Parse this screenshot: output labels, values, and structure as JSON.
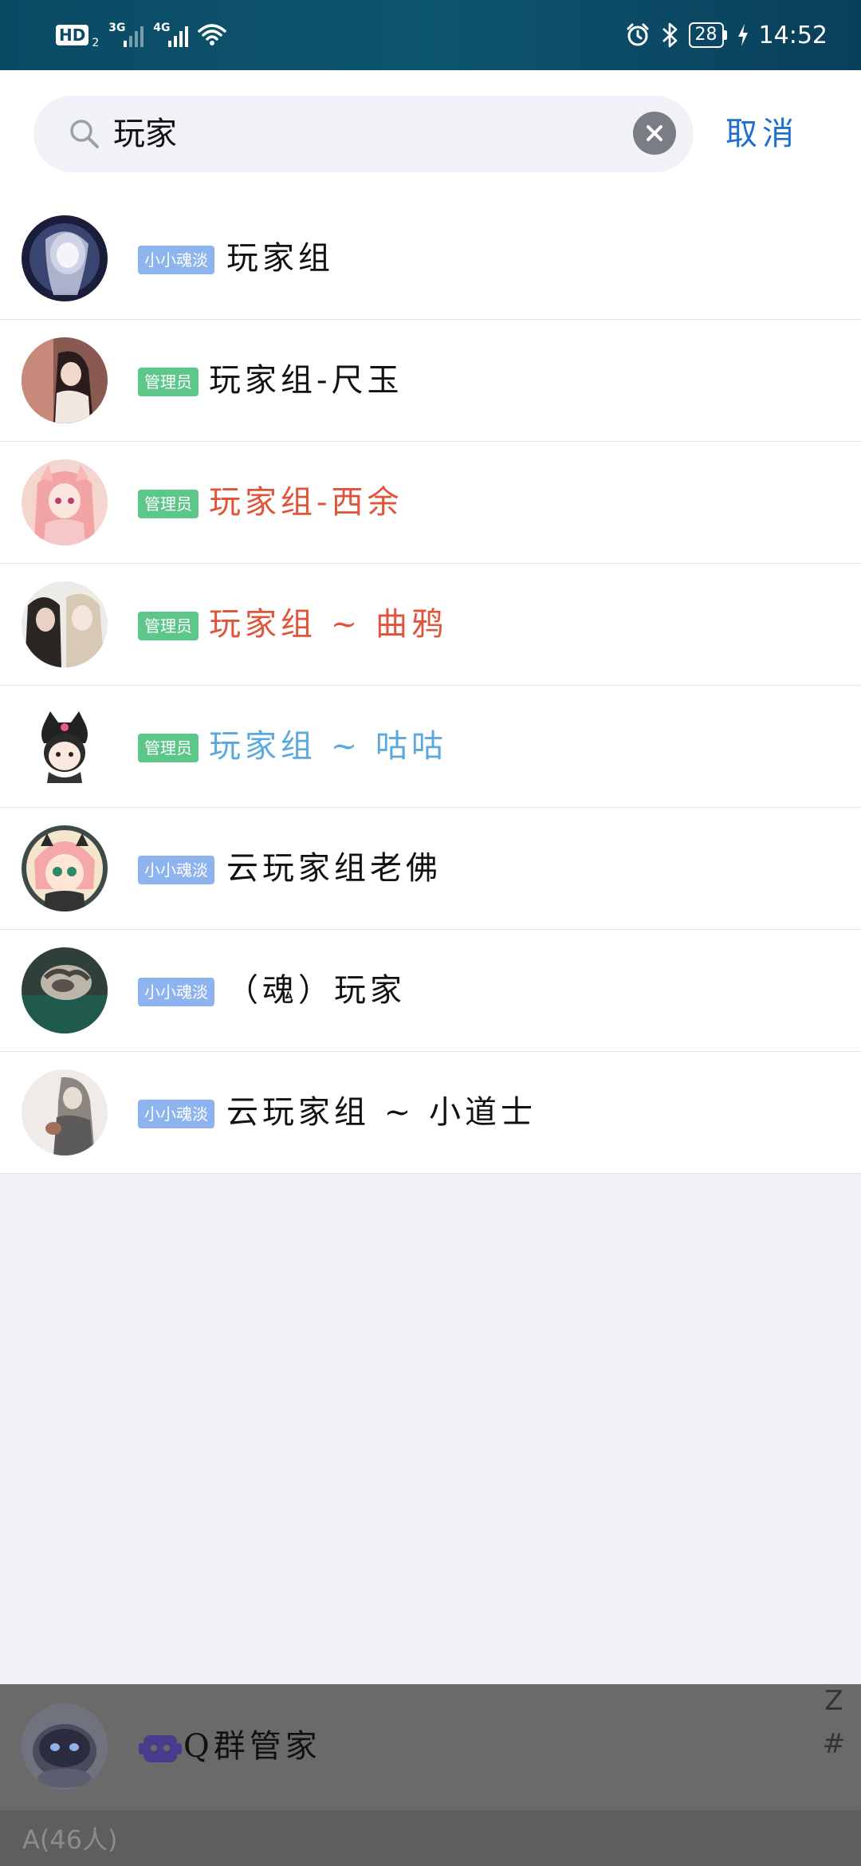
{
  "status_bar": {
    "hd": "HD",
    "hd_sub": "2",
    "net1": "3G",
    "net2": "4G",
    "battery": "28",
    "time": "14:52"
  },
  "search": {
    "query": "玩家",
    "cancel_label": "取消"
  },
  "results": [
    {
      "tag": "小小魂淡",
      "tag_type": "member",
      "name": "玩家组",
      "name_color": "#111111"
    },
    {
      "tag": "管理员",
      "tag_type": "admin",
      "name": "玩家组-尺玉",
      "name_color": "#111111"
    },
    {
      "tag": "管理员",
      "tag_type": "admin",
      "name": "玩家组-西余",
      "name_color": "#e0543a"
    },
    {
      "tag": "管理员",
      "tag_type": "admin",
      "name": "玩家组 ~ 曲鸦",
      "name_color": "#e0543a"
    },
    {
      "tag": "管理员",
      "tag_type": "admin",
      "name": "玩家组 ~ 咕咕",
      "name_color": "#5aa9dd"
    },
    {
      "tag": "小小魂淡",
      "tag_type": "member",
      "name": "云玩家组老佛",
      "name_color": "#111111"
    },
    {
      "tag": "小小魂淡",
      "tag_type": "member",
      "name": "（魂）玩家",
      "name_color": "#111111"
    },
    {
      "tag": "小小魂淡",
      "tag_type": "member",
      "name": "云玩家组 ~ 小道士",
      "name_color": "#111111"
    }
  ],
  "bottom": {
    "bot_name": "Q群管家",
    "index_letters": [
      "Z",
      "#"
    ],
    "section_label": "A(46人)"
  },
  "colors": {
    "accent": "#1f6fd1",
    "tag_member": "#8db4ee",
    "tag_admin": "#5cc788"
  },
  "icons": {
    "search": "search-icon",
    "clear": "close-circle-icon",
    "bot": "robot-icon",
    "wifi": "wifi-icon",
    "alarm": "alarm-icon",
    "bluetooth": "bluetooth-icon",
    "charging": "charging-icon"
  }
}
